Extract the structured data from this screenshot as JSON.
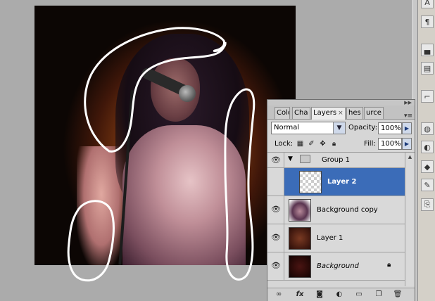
{
  "layers_panel": {
    "tabs": [
      {
        "label": "Colo",
        "active": false
      },
      {
        "label": "Cha",
        "active": false
      },
      {
        "label": "Layers",
        "active": true
      },
      {
        "label": "hes",
        "active": false
      },
      {
        "label": "urce",
        "active": false
      }
    ],
    "tab_close_glyph": "×",
    "blend_mode": "Normal",
    "opacity_label": "Opacity:",
    "opacity_value": "100%",
    "lock_label": "Lock:",
    "fill_label": "Fill:",
    "fill_value": "100%",
    "layers": [
      {
        "name": "Group 1",
        "type": "group",
        "visible": true,
        "selected": false,
        "italic": false
      },
      {
        "name": "Layer 2",
        "type": "layer",
        "visible": false,
        "selected": true,
        "italic": false,
        "thumb": "transparent"
      },
      {
        "name": "Background copy",
        "type": "layer",
        "visible": true,
        "selected": false,
        "italic": false,
        "thumb": "photo"
      },
      {
        "name": "Layer 1",
        "type": "layer",
        "visible": true,
        "selected": false,
        "italic": false,
        "thumb": "brown"
      },
      {
        "name": "Background",
        "type": "layer",
        "visible": true,
        "selected": false,
        "italic": true,
        "thumb": "dark-red",
        "locked": true
      }
    ],
    "footer_icons": [
      "link-icon",
      "fx-icon",
      "mask-icon",
      "adjustment-icon",
      "folder-icon",
      "new-layer-icon",
      "trash-icon"
    ]
  },
  "dock_icons": [
    "character-icon",
    "paragraph-icon",
    "histogram-icon",
    "navigator-icon",
    "paths-icon",
    "color-icon",
    "styles-icon",
    "layers-icon",
    "brushes-icon",
    "clone-icon"
  ],
  "colors": {
    "selection_blue": "#3b6cb8",
    "panel_gray": "#d6d6d6",
    "workspace_gray": "#ababab"
  }
}
